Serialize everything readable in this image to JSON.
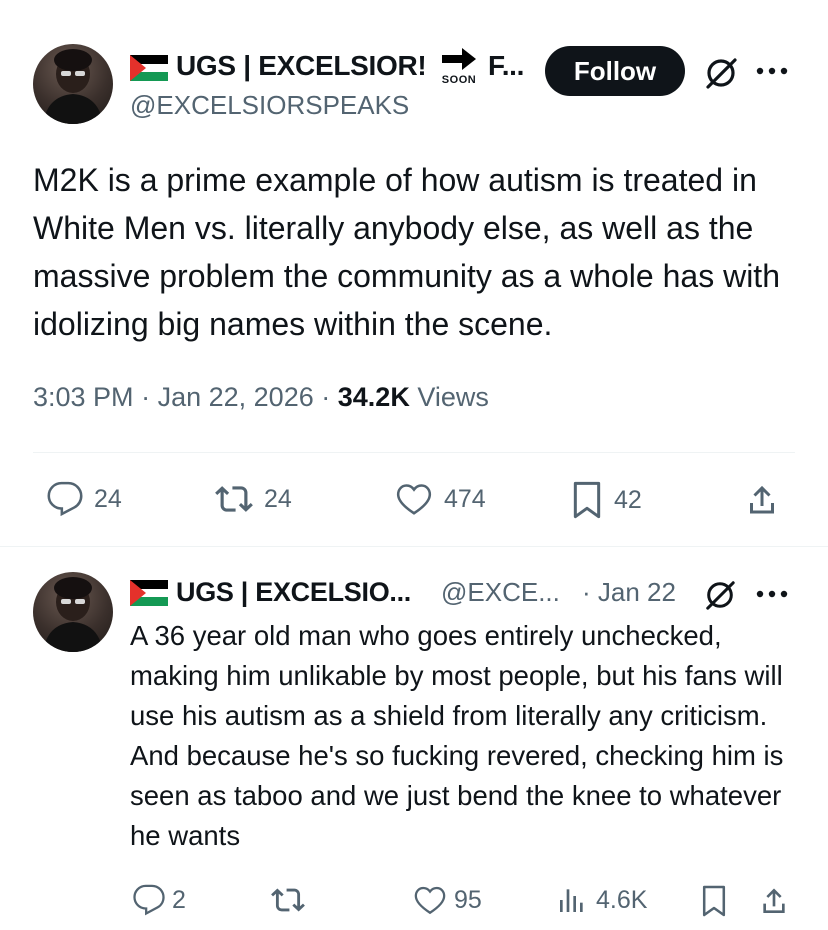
{
  "main_tweet": {
    "display_name": "UGS | EXCELSIOR!",
    "soon_label": "SOON",
    "name_overflow": "F...",
    "handle": "@EXCELSIORSPEAKS",
    "follow_label": "Follow",
    "more_icon": "more-horizontal-icon",
    "grok_icon": "grok-icon",
    "text": "M2K is a prime example of how autism is treated in White Men vs. literally anybody else, as well as the massive problem the community as a whole has with idolizing big names within the scene.",
    "time": "3:03 PM",
    "date": "Jan 22, 2026",
    "dot": "·",
    "views_count": "34.2K",
    "views_label": "Views",
    "actions": {
      "replies": "24",
      "reposts": "24",
      "likes": "474",
      "bookmarks": "42"
    }
  },
  "reply_tweet": {
    "display_name": "UGS | EXCELSIO...",
    "handle": "@EXCE...",
    "date": "· Jan 22",
    "text": "A 36 year old man who goes entirely unchecked, making him unlikable by most people, but his fans will use his autism as a shield from literally any criticism. And because he's so fucking revered, checking him is seen as taboo and we just bend the knee to whatever he wants",
    "actions": {
      "replies": "2",
      "reposts": "",
      "likes": "95",
      "views": "4.6K"
    }
  },
  "colors": {
    "text": "#0f1419",
    "muted": "#536471",
    "divider": "#eff3f4",
    "flag_red": "#e4312b",
    "flag_green": "#149954"
  }
}
